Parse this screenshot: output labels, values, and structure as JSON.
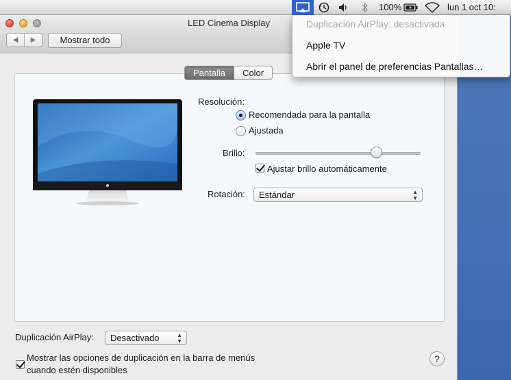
{
  "menubar": {
    "battery_percent": "100%",
    "clock": "lun 1 oct  10:",
    "icons": [
      "airplay-icon",
      "time-machine-icon",
      "volume-icon",
      "bluetooth-icon",
      "battery-icon",
      "wifi-icon"
    ]
  },
  "airplay_menu": {
    "status": "Duplicación AirPlay: desactivada",
    "device": "Apple TV",
    "open_prefs": "Abrir el panel de preferencias Pantallas…"
  },
  "window": {
    "title": "LED Cinema Display",
    "show_all": "Mostrar todo",
    "nav_back": "◀",
    "nav_forward": "▶"
  },
  "tabs": [
    {
      "label": "Pantalla",
      "active": true
    },
    {
      "label": "Color",
      "active": false
    }
  ],
  "display": {
    "resolution_label": "Resolución:",
    "resolution_options": [
      {
        "label": "Recomendada para la pantalla",
        "selected": true
      },
      {
        "label": "Ajustada",
        "selected": false
      }
    ],
    "brightness_label": "Brillo:",
    "brightness_level": 0.75,
    "auto_brightness_label": "Ajustar brillo automáticamente",
    "auto_brightness_checked": true,
    "rotation_label": "Rotación:",
    "rotation_value": "Estándar"
  },
  "airplay": {
    "label": "Duplicación AirPlay:",
    "value": "Desactivado",
    "show_in_menubar_line1": "Mostrar las opciones de duplicación en la barra de menús",
    "show_in_menubar_line2": "cuando estén disponibles",
    "show_in_menubar_checked": true
  },
  "help_label": "?",
  "colors": {
    "menu_highlight": "#2f63d4",
    "desktop": "#4370b4"
  }
}
